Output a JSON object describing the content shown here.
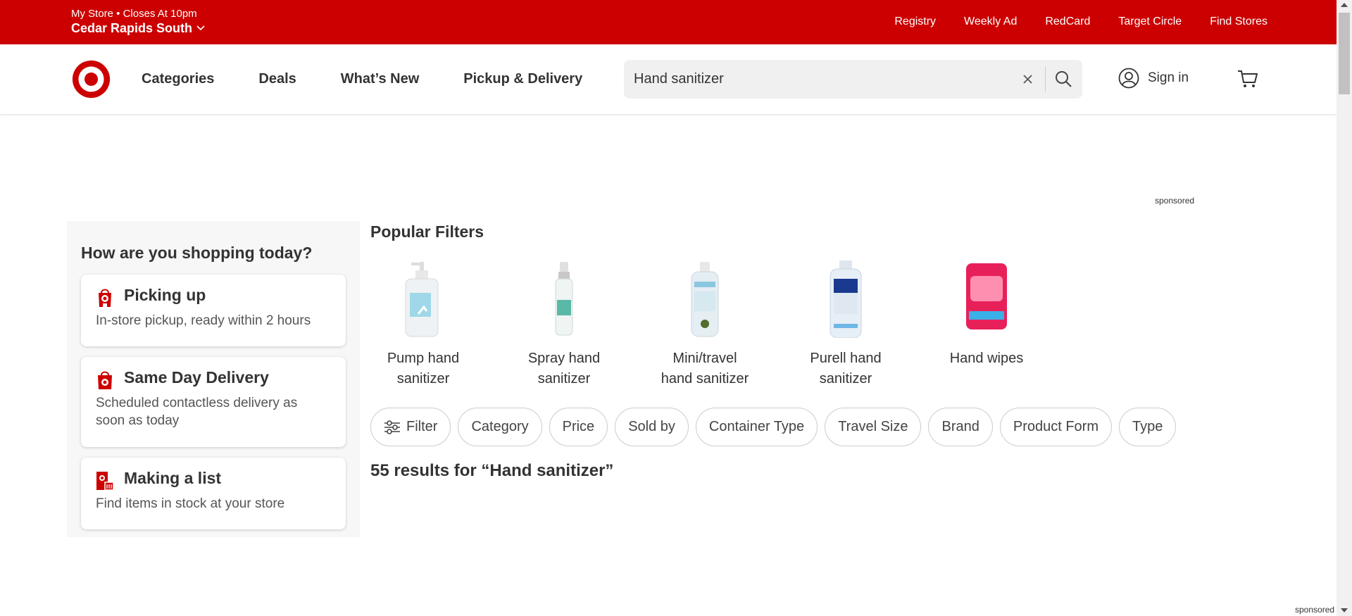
{
  "store": {
    "status": "My Store • Closes At 10pm",
    "name": "Cedar Rapids South"
  },
  "top_nav": [
    "Registry",
    "Weekly Ad",
    "RedCard",
    "Target Circle",
    "Find Stores"
  ],
  "main_nav": [
    "Categories",
    "Deals",
    "What’s New",
    "Pickup & Delivery"
  ],
  "search": {
    "value": "Hand sanitizer"
  },
  "account": {
    "signin_label": "Sign in"
  },
  "sponsored_label": "sponsored",
  "shopping": {
    "heading": "How are you shopping today?",
    "options": [
      {
        "title": "Picking up",
        "desc": "In-store pickup, ready within 2 hours",
        "icon": "store-pickup-icon"
      },
      {
        "title": "Same Day Delivery",
        "desc": "Scheduled contactless delivery as soon as today",
        "icon": "delivery-bag-icon"
      },
      {
        "title": "Making a list",
        "desc": "Find items in stock at your store",
        "icon": "store-list-icon"
      }
    ]
  },
  "popular_filters": {
    "title": "Popular Filters",
    "items": [
      {
        "line1": "Pump hand",
        "line2": "sanitizer",
        "image": "pump-bottle",
        "color": "#9fd8e8"
      },
      {
        "line1": "Spray hand",
        "line2": "sanitizer",
        "image": "spray-bottle",
        "color": "#5ab8a8"
      },
      {
        "line1": "Mini/travel",
        "line2": "hand sanitizer",
        "image": "mini-bottle",
        "color": "#8cc7e0"
      },
      {
        "line1": "Purell hand",
        "line2": "sanitizer",
        "image": "purell-bottle",
        "color": "#1a3a8f"
      },
      {
        "line1": "Hand wipes",
        "line2": "",
        "image": "wipes-pack",
        "color": "#e8205a"
      }
    ]
  },
  "filter_chips": [
    "Filter",
    "Category",
    "Price",
    "Sold by",
    "Container Type",
    "Travel Size",
    "Brand",
    "Product Form",
    "Type"
  ],
  "results": {
    "text": "55 results for “Hand sanitizer”"
  },
  "colors": {
    "brand_red": "#cc0000"
  }
}
